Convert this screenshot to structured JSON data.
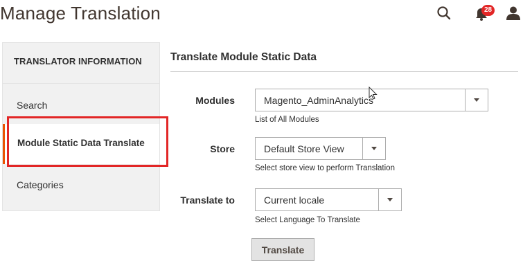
{
  "page": {
    "title": "Manage Translation"
  },
  "header": {
    "notifications_count": "28"
  },
  "sidebar": {
    "title": "TRANSLATOR INFORMATION",
    "items": [
      {
        "label": "Search",
        "active": false
      },
      {
        "label": "Module Static Data Translate",
        "active": true
      },
      {
        "label": "Categories",
        "active": false
      }
    ]
  },
  "main": {
    "section_title": "Translate Module Static Data",
    "fields": {
      "modules": {
        "label": "Modules",
        "value": "Magento_AdminAnalytics",
        "note": "List of All Modules"
      },
      "store": {
        "label": "Store",
        "value": "Default Store View",
        "note": "Select store view to perform Translation"
      },
      "translate_to": {
        "label": "Translate to",
        "value": "Current locale",
        "note": "Select Language To Translate"
      }
    },
    "button_label": "Translate"
  },
  "colors": {
    "accent": "#eb5202",
    "highlight": "#e22626",
    "badge": "#e22626"
  }
}
